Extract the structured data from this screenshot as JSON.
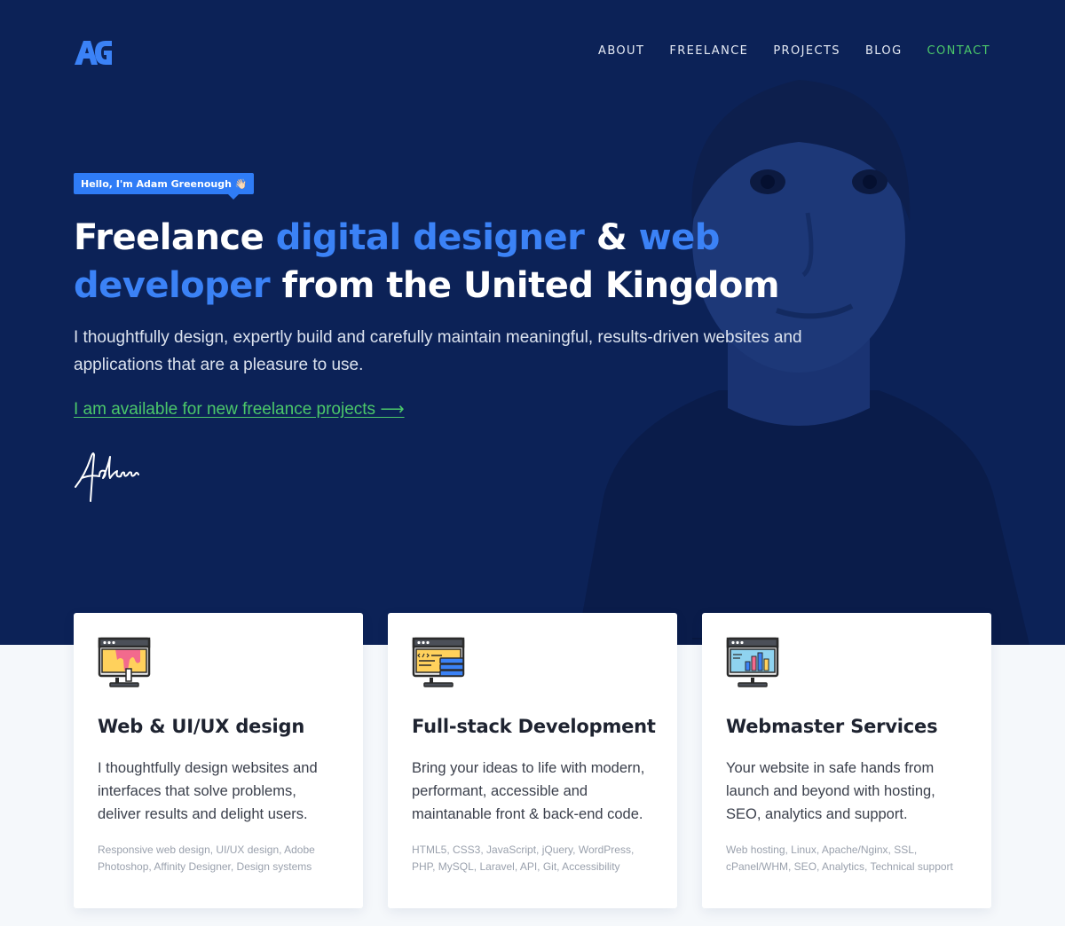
{
  "nav": {
    "logo_text": "AG",
    "items": [
      {
        "label": "ABOUT"
      },
      {
        "label": "FREELANCE"
      },
      {
        "label": "PROJECTS"
      },
      {
        "label": "BLOG"
      },
      {
        "label": "CONTACT"
      }
    ]
  },
  "hero": {
    "badge": "Hello, I'm Adam Greenough 👋🏻",
    "headline": {
      "part1": "Freelance ",
      "part2": "digital designer",
      "part3": " & ",
      "part4": "web developer",
      "part5": " from the United Kingdom"
    },
    "intro": "I thoughtfully design, expertly build and carefully maintain meaningful, results-driven websites and applications that are a pleasure to use.",
    "cta": "I am available for new freelance projects ⟶",
    "signature": "Adam"
  },
  "colors": {
    "hero_bg": "#0c2257",
    "accent_blue": "#3b82f6",
    "accent_green": "#4bc86a"
  },
  "services": [
    {
      "icon": "design-monitor-icon",
      "title": "Web & UI/UX design",
      "description": "I thoughtfully design websites and interfaces that solve problems, deliver results and delight users.",
      "tags": "Responsive web design, UI/UX design, Adobe Photoshop, Affinity Designer, Design systems"
    },
    {
      "icon": "code-monitor-icon",
      "title": "Full-stack Development",
      "description": "Bring your ideas to life with modern, performant, accessible and maintanable front & back-end code.",
      "tags": "HTML5, CSS3, JavaScript, jQuery, WordPress, PHP, MySQL, Laravel, API, Git, Accessibility"
    },
    {
      "icon": "analytics-monitor-icon",
      "title": "Webmaster Services",
      "description": "Your website in safe hands from launch and beyond with hosting, SEO, analytics and support.",
      "tags": "Web hosting, Linux, Apache/Nginx, SSL, cPanel/WHM, SEO, Analytics, Technical support"
    }
  ]
}
